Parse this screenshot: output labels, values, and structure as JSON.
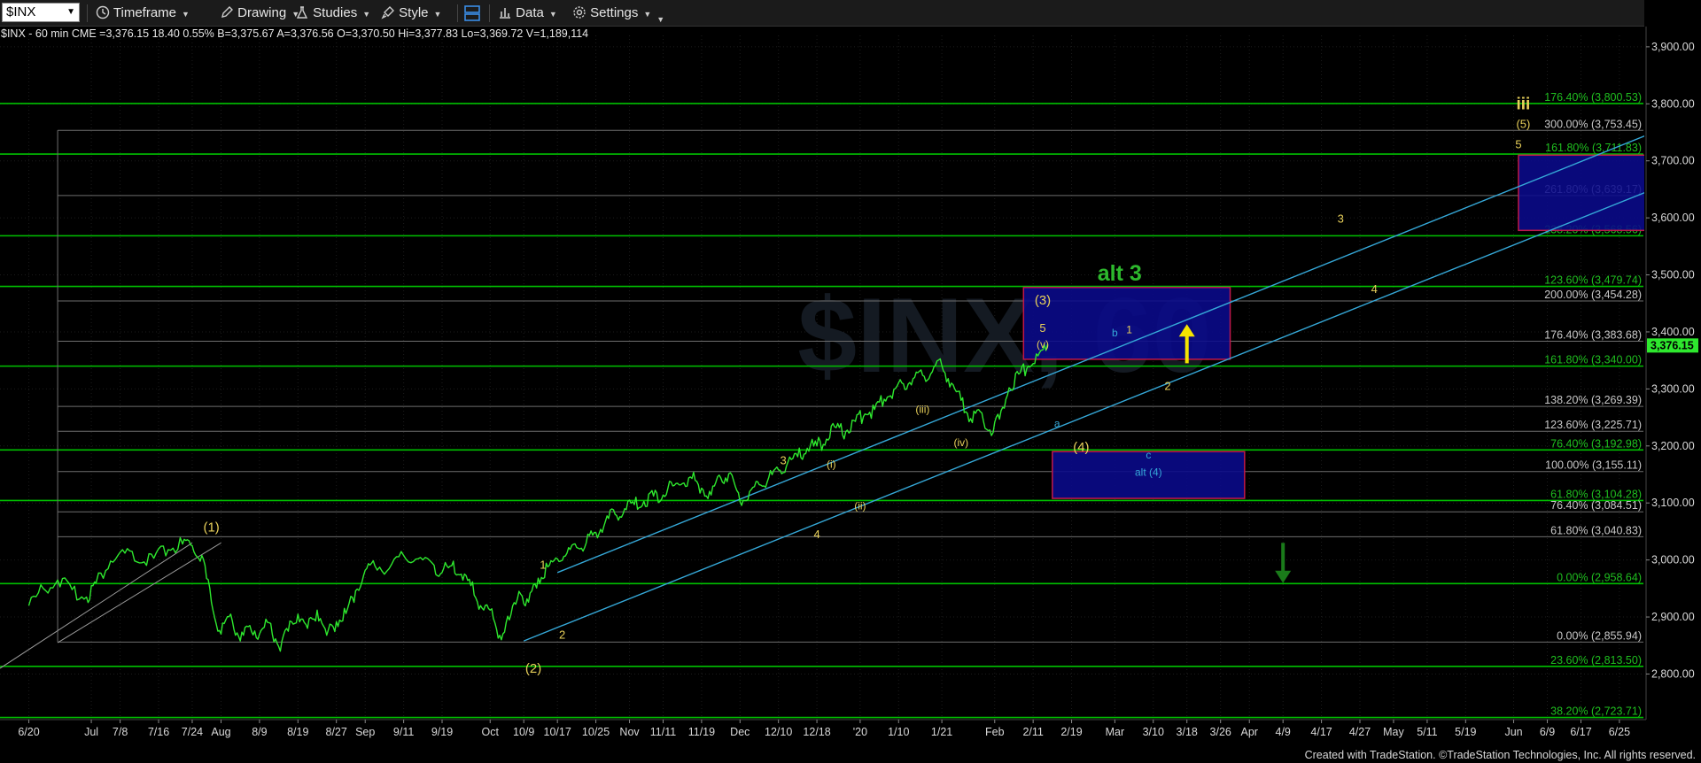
{
  "toolbar": {
    "symbol": "$INX",
    "timeframe": "Timeframe",
    "drawing": "Drawing",
    "studies": "Studies",
    "style": "Style",
    "data": "Data",
    "settings": "Settings"
  },
  "quote_line": "$INX - 60 min  CME  =3,376.15  18.40  0.55%   B=3,375.67   A=3,376.56   O=3,370.50   Hi=3,377.83   Lo=3,369.72   V=1,189,114",
  "footer": "Created with TradeStation. ©TradeStation Technologies, Inc. All rights reserved.",
  "watermark": "$INX, 60",
  "colors": {
    "price": "#2ee82e",
    "fib_level": "#00c000",
    "fib_text": "#c8c8c8",
    "fib_text_green": "#1fbf1f",
    "channel": "#35a8d8",
    "box_fill": "#0a0a8c",
    "box_border": "#c0184a",
    "wave_label": "#e8d05a",
    "alt_label": "#2db82d",
    "up_arrow": "#f5e400",
    "down_arrow": "#1a7a1a",
    "last_price_bg": "#2ee82e"
  },
  "chart_data": {
    "type": "line",
    "title": "$INX - 60 min",
    "ylim": [
      2720,
      3920
    ],
    "y_ticks": [
      "3,900.00",
      "3,800.00",
      "3,700.00",
      "3,600.00",
      "3,500.00",
      "3,400.00",
      "3,300.00",
      "3,200.00",
      "3,100.00",
      "3,000.00",
      "2,900.00",
      "2,800.00"
    ],
    "y_tick_values": [
      3900,
      3800,
      3700,
      3600,
      3500,
      3400,
      3300,
      3200,
      3100,
      3000,
      2900,
      2800
    ],
    "x_ticks": [
      "6/20",
      "Jul",
      "7/8",
      "7/16",
      "7/24",
      "Aug",
      "8/9",
      "8/19",
      "8/27",
      "Sep",
      "9/11",
      "9/19",
      "Oct",
      "10/9",
      "10/17",
      "10/25",
      "Nov",
      "11/11",
      "11/19",
      "Dec",
      "12/10",
      "12/18",
      "'20",
      "1/10",
      "1/21",
      "Feb",
      "2/11",
      "2/19",
      "Mar",
      "3/10",
      "3/18",
      "3/26",
      "Apr",
      "4/9",
      "4/17",
      "4/27",
      "May",
      "5/11",
      "5/19",
      "Jun",
      "6/9",
      "6/17",
      "6/25"
    ],
    "x_tick_index": [
      0,
      13,
      19,
      27,
      34,
      40,
      48,
      56,
      64,
      70,
      78,
      86,
      96,
      103,
      110,
      118,
      125,
      132,
      140,
      148,
      156,
      164,
      173,
      181,
      190,
      201,
      209,
      217,
      226,
      234,
      241,
      248,
      254,
      261,
      269,
      277,
      284,
      291,
      299,
      309,
      316,
      323,
      331
    ],
    "last_price": "3,376.15",
    "last_price_value": 3376.15,
    "price_series": {
      "name": "$INX",
      "x": [
        0,
        3,
        6,
        9,
        12,
        14,
        17,
        20,
        23,
        26,
        29,
        32,
        34,
        36,
        38,
        40,
        42,
        44,
        46,
        48,
        50,
        52,
        54,
        56,
        58,
        60,
        62,
        64,
        66,
        68,
        70,
        72,
        75,
        78,
        81,
        84,
        86,
        88,
        90,
        92,
        94,
        96,
        98,
        100,
        102,
        104,
        106,
        108,
        110,
        112,
        114,
        116,
        118,
        120,
        122,
        124,
        126,
        128,
        130,
        132,
        134,
        136,
        138,
        140,
        142,
        144,
        146,
        148,
        150,
        152,
        154,
        156,
        158,
        160,
        162,
        164,
        166,
        168,
        170,
        172,
        174,
        176,
        178,
        180,
        182,
        184,
        186,
        188,
        190,
        192,
        194,
        196,
        198,
        200,
        202,
        204,
        206,
        208,
        210,
        212
      ],
      "y": [
        2920,
        2950,
        2965,
        2948,
        2935,
        2960,
        2998,
        3012,
        2995,
        3003,
        3018,
        3028,
        3025,
        3008,
        2925,
        2870,
        2905,
        2858,
        2885,
        2870,
        2890,
        2848,
        2875,
        2905,
        2880,
        2912,
        2868,
        2892,
        2906,
        2946,
        2982,
        2990,
        2985,
        3008,
        3002,
        2994,
        2978,
        2990,
        2975,
        2955,
        2920,
        2912,
        2868,
        2895,
        2945,
        2926,
        2968,
        2988,
        3002,
        3012,
        3022,
        3030,
        3048,
        3068,
        3080,
        3090,
        3097,
        3103,
        3112,
        3114,
        3130,
        3134,
        3143,
        3126,
        3114,
        3144,
        3153,
        3102,
        3120,
        3132,
        3145,
        3158,
        3172,
        3181,
        3196,
        3200,
        3212,
        3232,
        3225,
        3243,
        3256,
        3264,
        3282,
        3299,
        3309,
        3318,
        3324,
        3330,
        3341,
        3310,
        3280,
        3248,
        3260,
        3228,
        3247,
        3302,
        3326,
        3340,
        3358,
        3378
      ]
    },
    "fib_levels": [
      {
        "label": "176.40% (3,800.53)",
        "value": 3800.53,
        "green": true,
        "line": "green"
      },
      {
        "label": "300.00% (3,753.45)",
        "value": 3753.45,
        "green": false,
        "line": "gray"
      },
      {
        "label": "161.80% (3,711.83)",
        "value": 3711.83,
        "green": true,
        "line": "green"
      },
      {
        "label": "261.80% (3,639.17)",
        "value": 3639.17,
        "green": false,
        "line": "gray"
      },
      {
        "label": "238.20% (3,568.56)",
        "value": 3568.56,
        "green": true,
        "line": "green"
      },
      {
        "label": "123.60% (3,479.74)",
        "value": 3479.74,
        "green": true,
        "line": "green"
      },
      {
        "label": "200.00% (3,454.28)",
        "value": 3454.28,
        "green": false,
        "line": "gray"
      },
      {
        "label": "176.40% (3,383.68)",
        "value": 3383.68,
        "green": false,
        "line": "gray"
      },
      {
        "label": "161.80% (3,340.00)",
        "value": 3340.0,
        "green": true,
        "line": "green"
      },
      {
        "label": "138.20% (3,269.39)",
        "value": 3269.39,
        "green": false,
        "line": "gray"
      },
      {
        "label": "123.60% (3,225.71)",
        "value": 3225.71,
        "green": false,
        "line": "gray"
      },
      {
        "label": "76.40% (3,192.98)",
        "value": 3192.98,
        "green": true,
        "line": "green"
      },
      {
        "label": "100.00% (3,155.11)",
        "value": 3155.11,
        "green": false,
        "line": "gray"
      },
      {
        "label": "61.80% (3,104.28)",
        "value": 3104.28,
        "green": true,
        "line": "green"
      },
      {
        "label": "76.40% (3,084.51)",
        "value": 3084.51,
        "green": false,
        "line": "gray"
      },
      {
        "label": "61.80% (3,040.83)",
        "value": 3040.83,
        "green": false,
        "line": "gray"
      },
      {
        "label": "0.00% (2,958.64)",
        "value": 2958.64,
        "green": true,
        "line": "green"
      },
      {
        "label": "0.00% (2,855.94)",
        "value": 2855.94,
        "green": false,
        "line": "gray"
      },
      {
        "label": "23.60% (2,813.50)",
        "value": 2813.5,
        "green": true,
        "line": "green"
      },
      {
        "label": "38.20% (2,723.71)",
        "value": 2723.71,
        "green": true,
        "line": "green"
      }
    ],
    "channels": [
      {
        "name": "upper",
        "from": [
          110,
          2978
        ],
        "to": [
          386,
          3912
        ]
      },
      {
        "name": "lower",
        "from": [
          103,
          2858
        ],
        "to": [
          386,
          3812
        ]
      }
    ],
    "boxes": [
      {
        "name": "target-box-3",
        "x0": 207,
        "x1": 250,
        "y_top": 3478,
        "y_bottom": 3352
      },
      {
        "name": "alt-4-box",
        "x0": 213,
        "x1": 253,
        "y_top": 3190,
        "y_bottom": 3108
      },
      {
        "name": "target-box-5",
        "x0": 310,
        "x1": 361,
        "y_top": 3710,
        "y_bottom": 3578
      }
    ],
    "annotations": [
      {
        "text": "(1)",
        "x": 38,
        "y": 3050,
        "color": "wave",
        "size": 15
      },
      {
        "text": "(2)",
        "x": 105,
        "y": 2802,
        "color": "wave",
        "size": 15
      },
      {
        "text": "1",
        "x": 107,
        "y": 2985,
        "color": "wave",
        "size": 13
      },
      {
        "text": "2",
        "x": 111,
        "y": 2862,
        "color": "wave",
        "size": 13
      },
      {
        "text": "3",
        "x": 157,
        "y": 3168,
        "color": "wave",
        "size": 13
      },
      {
        "text": "4",
        "x": 164,
        "y": 3038,
        "color": "wave",
        "size": 13
      },
      {
        "text": "(i)",
        "x": 167,
        "y": 3162,
        "color": "wave",
        "size": 12
      },
      {
        "text": "(ii)",
        "x": 173,
        "y": 3089,
        "color": "wave",
        "size": 12
      },
      {
        "text": "(iii)",
        "x": 186,
        "y": 3258,
        "color": "wave",
        "size": 12
      },
      {
        "text": "(iv)",
        "x": 194,
        "y": 3200,
        "color": "wave",
        "size": 12
      },
      {
        "text": "(v)",
        "x": 211,
        "y": 3372,
        "color": "wave",
        "size": 12
      },
      {
        "text": "5",
        "x": 211,
        "y": 3400,
        "color": "wave",
        "size": 13
      },
      {
        "text": "(3)",
        "x": 211,
        "y": 3448,
        "color": "wave",
        "size": 15
      },
      {
        "text": "alt 3",
        "x": 227,
        "y": 3490,
        "color": "alt",
        "size": 25
      },
      {
        "text": "a",
        "x": 214,
        "y": 3233,
        "color": "channel",
        "size": 12
      },
      {
        "text": "(4)",
        "x": 219,
        "y": 3190,
        "color": "wave",
        "size": 15
      },
      {
        "text": "b",
        "x": 226,
        "y": 3392,
        "color": "channel",
        "size": 12
      },
      {
        "text": "1",
        "x": 229,
        "y": 3398,
        "color": "wave",
        "size": 12
      },
      {
        "text": "c",
        "x": 233,
        "y": 3178,
        "color": "channel",
        "size": 12
      },
      {
        "text": "alt (4)",
        "x": 233,
        "y": 3148,
        "color": "channel",
        "size": 12
      },
      {
        "text": "2",
        "x": 237,
        "y": 3298,
        "color": "wave",
        "size": 13
      },
      {
        "text": "3",
        "x": 273,
        "y": 3592,
        "color": "wave",
        "size": 13
      },
      {
        "text": "4",
        "x": 280,
        "y": 3468,
        "color": "wave",
        "size": 13
      },
      {
        "text": "5",
        "x": 310,
        "y": 3722,
        "color": "wave",
        "size": 13
      },
      {
        "text": "(5)",
        "x": 311,
        "y": 3758,
        "color": "wave",
        "size": 13
      },
      {
        "text": "iii",
        "x": 311,
        "y": 3790,
        "color": "wave",
        "size": 19
      }
    ],
    "arrows": [
      {
        "name": "up-arrow",
        "direction": "up",
        "x": 241,
        "y_from": 3345,
        "y_to": 3395
      },
      {
        "name": "down-arrow",
        "direction": "down",
        "x": 261,
        "y_from": 3030,
        "y_to": 2978
      }
    ]
  }
}
